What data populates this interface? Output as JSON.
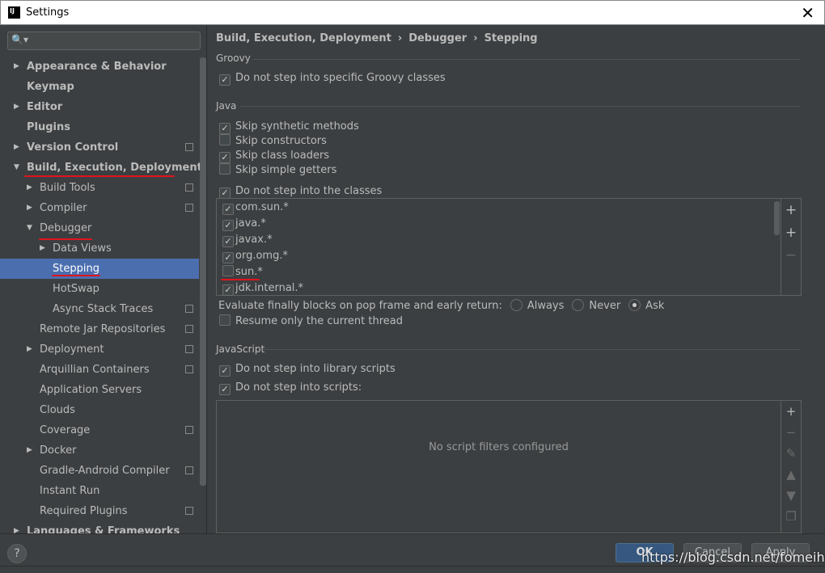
{
  "window": {
    "title": "Settings",
    "close_icon": "close-icon"
  },
  "sidebar": {
    "search_placeholder": "",
    "items": [
      {
        "label": "Appearance & Behavior",
        "level": 0,
        "arrow": "right",
        "bold": true
      },
      {
        "label": "Keymap",
        "level": 0,
        "bold": true
      },
      {
        "label": "Editor",
        "level": 0,
        "arrow": "right",
        "bold": true
      },
      {
        "label": "Plugins",
        "level": 0,
        "bold": true
      },
      {
        "label": "Version Control",
        "level": 0,
        "arrow": "right",
        "bold": true,
        "badge": true
      },
      {
        "label": "Build, Execution, Deployment",
        "level": 0,
        "arrow": "down",
        "bold": true
      },
      {
        "label": "Build Tools",
        "level": 1,
        "arrow": "right",
        "badge": true
      },
      {
        "label": "Compiler",
        "level": 1,
        "arrow": "right",
        "badge": true
      },
      {
        "label": "Debugger",
        "level": 1,
        "arrow": "down"
      },
      {
        "label": "Data Views",
        "level": 2,
        "arrow": "right"
      },
      {
        "label": "Stepping",
        "level": 2,
        "selected": true
      },
      {
        "label": "HotSwap",
        "level": 2
      },
      {
        "label": "Async Stack Traces",
        "level": 2,
        "badge": true
      },
      {
        "label": "Remote Jar Repositories",
        "level": 1,
        "badge": true
      },
      {
        "label": "Deployment",
        "level": 1,
        "arrow": "right",
        "badge": true
      },
      {
        "label": "Arquillian Containers",
        "level": 1,
        "badge": true
      },
      {
        "label": "Application Servers",
        "level": 1
      },
      {
        "label": "Clouds",
        "level": 1
      },
      {
        "label": "Coverage",
        "level": 1,
        "badge": true
      },
      {
        "label": "Docker",
        "level": 1,
        "arrow": "right"
      },
      {
        "label": "Gradle-Android Compiler",
        "level": 1,
        "badge": true
      },
      {
        "label": "Instant Run",
        "level": 1
      },
      {
        "label": "Required Plugins",
        "level": 1,
        "badge": true
      },
      {
        "label": "Languages & Frameworks",
        "level": 0,
        "arrow": "right",
        "bold": true
      }
    ]
  },
  "breadcrumb": [
    "Build, Execution, Deployment",
    "Debugger",
    "Stepping"
  ],
  "groovy": {
    "title": "Groovy",
    "no_step_groovy": {
      "label": "Do not step into specific Groovy classes",
      "checked": true
    }
  },
  "java": {
    "title": "Java",
    "options": [
      {
        "label": "Skip synthetic methods",
        "checked": true
      },
      {
        "label": "Skip constructors",
        "checked": false
      },
      {
        "label": "Skip class loaders",
        "checked": true
      },
      {
        "label": "Skip simple getters",
        "checked": false
      },
      {
        "label": "Do not step into the classes",
        "checked": true
      }
    ],
    "classes": [
      {
        "label": "com.sun.*",
        "checked": true
      },
      {
        "label": "java.*",
        "checked": true
      },
      {
        "label": "javax.*",
        "checked": true
      },
      {
        "label": "org.omg.*",
        "checked": true
      },
      {
        "label": "sun.*",
        "checked": false
      },
      {
        "label": "jdk.internal.*",
        "checked": true
      }
    ],
    "evaluate_label": "Evaluate finally blocks on pop frame and early return:",
    "evaluate_options": [
      "Always",
      "Never",
      "Ask"
    ],
    "evaluate_selected": "Ask",
    "resume_only": {
      "label": "Resume only the current thread",
      "checked": false
    }
  },
  "javascript": {
    "title": "JavaScript",
    "no_step_library": {
      "label": "Do not step into library scripts",
      "checked": true
    },
    "no_step_scripts": {
      "label": "Do not step into scripts:",
      "checked": true
    },
    "empty_text": "No script filters configured"
  },
  "buttons": {
    "ok": "OK",
    "cancel": "Cancel",
    "apply": "Apply",
    "help": "?"
  },
  "watermark": "https://blog.csdn.net/fomeiherz",
  "colors": {
    "selection": "#4b6eaf",
    "background": "#3c3f41",
    "annotation": "#e0141e"
  }
}
